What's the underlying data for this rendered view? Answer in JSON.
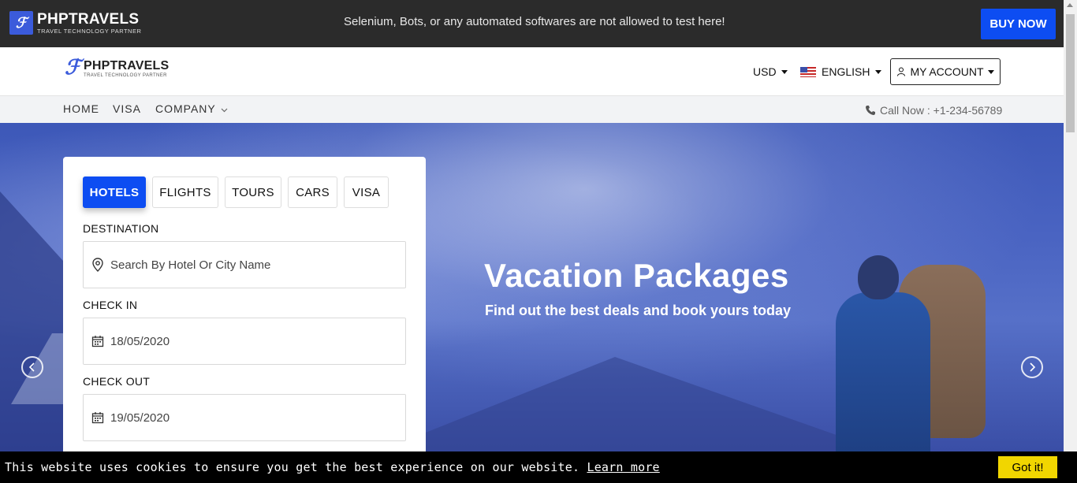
{
  "topbar": {
    "logo_title": "PHPTRAVELS",
    "logo_subtitle": "TRAVEL TECHNOLOGY PARTNER",
    "notice": "Selenium, Bots, or any automated softwares are not allowed to test here!",
    "buy_label": "BUY NOW"
  },
  "header": {
    "logo_title": "PHPTRAVELS",
    "logo_subtitle": "TRAVEL TECHNOLOGY PARTNER",
    "currency": "USD",
    "language": "ENGLISH",
    "account_label": "MY ACCOUNT"
  },
  "nav": {
    "items": [
      "HOME",
      "VISA",
      "COMPANY"
    ],
    "call": "Call Now : +1-234-56789"
  },
  "search": {
    "tabs": [
      "HOTELS",
      "FLIGHTS",
      "TOURS",
      "CARS",
      "VISA"
    ],
    "active_tab": "HOTELS",
    "destination_label": "DESTINATION",
    "destination_placeholder": "Search By Hotel Or City Name",
    "checkin_label": "CHECK IN",
    "checkin_value": "18/05/2020",
    "checkout_label": "CHECK OUT",
    "checkout_value": "19/05/2020"
  },
  "hero": {
    "title": "Vacation Packages",
    "subtitle": "Find out the best deals and book yours today"
  },
  "cookie": {
    "text": "This website uses cookies to ensure you get the best experience on our website.",
    "link": "Learn more",
    "button": "Got it!"
  },
  "colors": {
    "accent": "#0d4df2",
    "topbar": "#2b2b2b",
    "cookie_button": "#f1d600"
  }
}
